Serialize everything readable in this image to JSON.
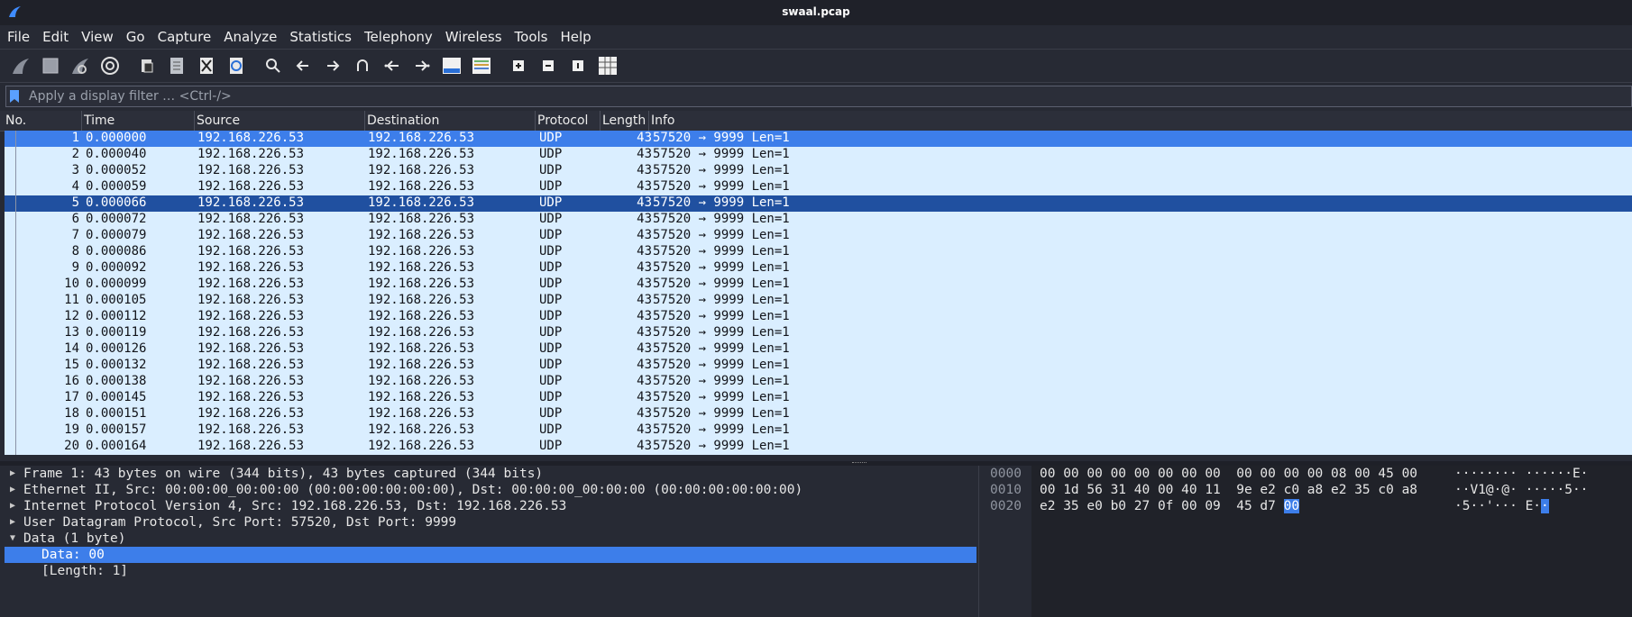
{
  "window": {
    "title": "swaal.pcap"
  },
  "menu": [
    "File",
    "Edit",
    "View",
    "Go",
    "Capture",
    "Analyze",
    "Statistics",
    "Telephony",
    "Wireless",
    "Tools",
    "Help"
  ],
  "filter": {
    "placeholder": "Apply a display filter … <Ctrl-/>"
  },
  "columns": {
    "no": "No.",
    "time": "Time",
    "source": "Source",
    "destination": "Destination",
    "protocol": "Protocol",
    "length": "Length",
    "info": "Info"
  },
  "packets": [
    {
      "no": "1",
      "time": "0.000000",
      "src": "192.168.226.53",
      "dst": "192.168.226.53",
      "proto": "UDP",
      "len": "43",
      "info": "57520 → 9999 Len=1"
    },
    {
      "no": "2",
      "time": "0.000040",
      "src": "192.168.226.53",
      "dst": "192.168.226.53",
      "proto": "UDP",
      "len": "43",
      "info": "57520 → 9999 Len=1"
    },
    {
      "no": "3",
      "time": "0.000052",
      "src": "192.168.226.53",
      "dst": "192.168.226.53",
      "proto": "UDP",
      "len": "43",
      "info": "57520 → 9999 Len=1"
    },
    {
      "no": "4",
      "time": "0.000059",
      "src": "192.168.226.53",
      "dst": "192.168.226.53",
      "proto": "UDP",
      "len": "43",
      "info": "57520 → 9999 Len=1"
    },
    {
      "no": "5",
      "time": "0.000066",
      "src": "192.168.226.53",
      "dst": "192.168.226.53",
      "proto": "UDP",
      "len": "43",
      "info": "57520 → 9999 Len=1"
    },
    {
      "no": "6",
      "time": "0.000072",
      "src": "192.168.226.53",
      "dst": "192.168.226.53",
      "proto": "UDP",
      "len": "43",
      "info": "57520 → 9999 Len=1"
    },
    {
      "no": "7",
      "time": "0.000079",
      "src": "192.168.226.53",
      "dst": "192.168.226.53",
      "proto": "UDP",
      "len": "43",
      "info": "57520 → 9999 Len=1"
    },
    {
      "no": "8",
      "time": "0.000086",
      "src": "192.168.226.53",
      "dst": "192.168.226.53",
      "proto": "UDP",
      "len": "43",
      "info": "57520 → 9999 Len=1"
    },
    {
      "no": "9",
      "time": "0.000092",
      "src": "192.168.226.53",
      "dst": "192.168.226.53",
      "proto": "UDP",
      "len": "43",
      "info": "57520 → 9999 Len=1"
    },
    {
      "no": "10",
      "time": "0.000099",
      "src": "192.168.226.53",
      "dst": "192.168.226.53",
      "proto": "UDP",
      "len": "43",
      "info": "57520 → 9999 Len=1"
    },
    {
      "no": "11",
      "time": "0.000105",
      "src": "192.168.226.53",
      "dst": "192.168.226.53",
      "proto": "UDP",
      "len": "43",
      "info": "57520 → 9999 Len=1"
    },
    {
      "no": "12",
      "time": "0.000112",
      "src": "192.168.226.53",
      "dst": "192.168.226.53",
      "proto": "UDP",
      "len": "43",
      "info": "57520 → 9999 Len=1"
    },
    {
      "no": "13",
      "time": "0.000119",
      "src": "192.168.226.53",
      "dst": "192.168.226.53",
      "proto": "UDP",
      "len": "43",
      "info": "57520 → 9999 Len=1"
    },
    {
      "no": "14",
      "time": "0.000126",
      "src": "192.168.226.53",
      "dst": "192.168.226.53",
      "proto": "UDP",
      "len": "43",
      "info": "57520 → 9999 Len=1"
    },
    {
      "no": "15",
      "time": "0.000132",
      "src": "192.168.226.53",
      "dst": "192.168.226.53",
      "proto": "UDP",
      "len": "43",
      "info": "57520 → 9999 Len=1"
    },
    {
      "no": "16",
      "time": "0.000138",
      "src": "192.168.226.53",
      "dst": "192.168.226.53",
      "proto": "UDP",
      "len": "43",
      "info": "57520 → 9999 Len=1"
    },
    {
      "no": "17",
      "time": "0.000145",
      "src": "192.168.226.53",
      "dst": "192.168.226.53",
      "proto": "UDP",
      "len": "43",
      "info": "57520 → 9999 Len=1"
    },
    {
      "no": "18",
      "time": "0.000151",
      "src": "192.168.226.53",
      "dst": "192.168.226.53",
      "proto": "UDP",
      "len": "43",
      "info": "57520 → 9999 Len=1"
    },
    {
      "no": "19",
      "time": "0.000157",
      "src": "192.168.226.53",
      "dst": "192.168.226.53",
      "proto": "UDP",
      "len": "43",
      "info": "57520 → 9999 Len=1"
    },
    {
      "no": "20",
      "time": "0.000164",
      "src": "192.168.226.53",
      "dst": "192.168.226.53",
      "proto": "UDP",
      "len": "43",
      "info": "57520 → 9999 Len=1"
    }
  ],
  "details": [
    "Frame 1: 43 bytes on wire (344 bits), 43 bytes captured (344 bits)",
    "Ethernet II, Src: 00:00:00_00:00:00 (00:00:00:00:00:00), Dst: 00:00:00_00:00:00 (00:00:00:00:00:00)",
    "Internet Protocol Version 4, Src: 192.168.226.53, Dst: 192.168.226.53",
    "User Datagram Protocol, Src Port: 57520, Dst Port: 9999",
    "Data (1 byte)",
    "Data: 00",
    "[Length: 1]"
  ],
  "hex": [
    {
      "offset": "0000",
      "bytes": "00 00 00 00 00 00 00 00  00 00 00 00 08 00 45 00",
      "ascii": "········ ······E·"
    },
    {
      "offset": "0010",
      "bytes": "00 1d 56 31 40 00 40 11  9e e2 c0 a8 e2 35 c0 a8",
      "ascii": "··V1@·@· ·····5··"
    },
    {
      "offset": "0020",
      "bytes": "e2 35 e0 b0 27 0f 00 09  45 d7 ",
      "bytes_hl": "00",
      "ascii": "·5··'··· E·",
      "ascii_hl": "·"
    }
  ]
}
